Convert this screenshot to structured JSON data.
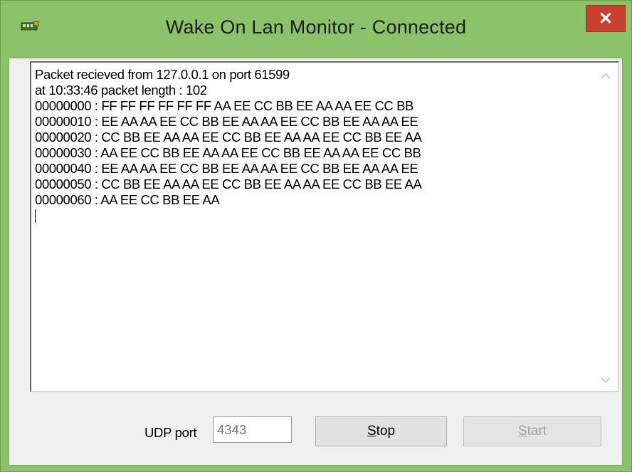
{
  "window": {
    "title": "Wake On Lan Monitor - Connected",
    "close_glyph": "✕",
    "accent_color": "#8cc26a",
    "close_color": "#c7402f"
  },
  "log": {
    "lines": [
      "Packet recieved from 127.0.0.1 on port 61599",
      "at 10:33:46 packet length : 102",
      "00000000 : FF FF FF FF FF FF AA EE CC BB EE AA AA EE CC BB",
      "00000010 : EE AA AA EE CC BB EE AA AA EE CC BB EE AA AA EE",
      "00000020 : CC BB EE AA AA EE CC BB EE AA AA EE CC BB EE AA",
      "00000030 : AA EE CC BB EE AA AA EE CC BB EE AA AA EE CC BB",
      "00000040 : EE AA AA EE CC BB EE AA AA EE CC BB EE AA AA EE",
      "00000050 : CC BB EE AA AA EE CC BB EE AA AA EE CC BB EE AA",
      "00000060 : AA EE CC BB EE AA"
    ]
  },
  "controls": {
    "udp_label": "UDP port",
    "udp_value": "4343",
    "stop_first": "S",
    "stop_rest": "top",
    "start_first": "S",
    "start_rest": "tart"
  },
  "icons": {
    "app": "network-adapter-icon",
    "scroll_up": "scroll-up-arrow-icon",
    "scroll_down": "scroll-down-arrow-icon"
  }
}
